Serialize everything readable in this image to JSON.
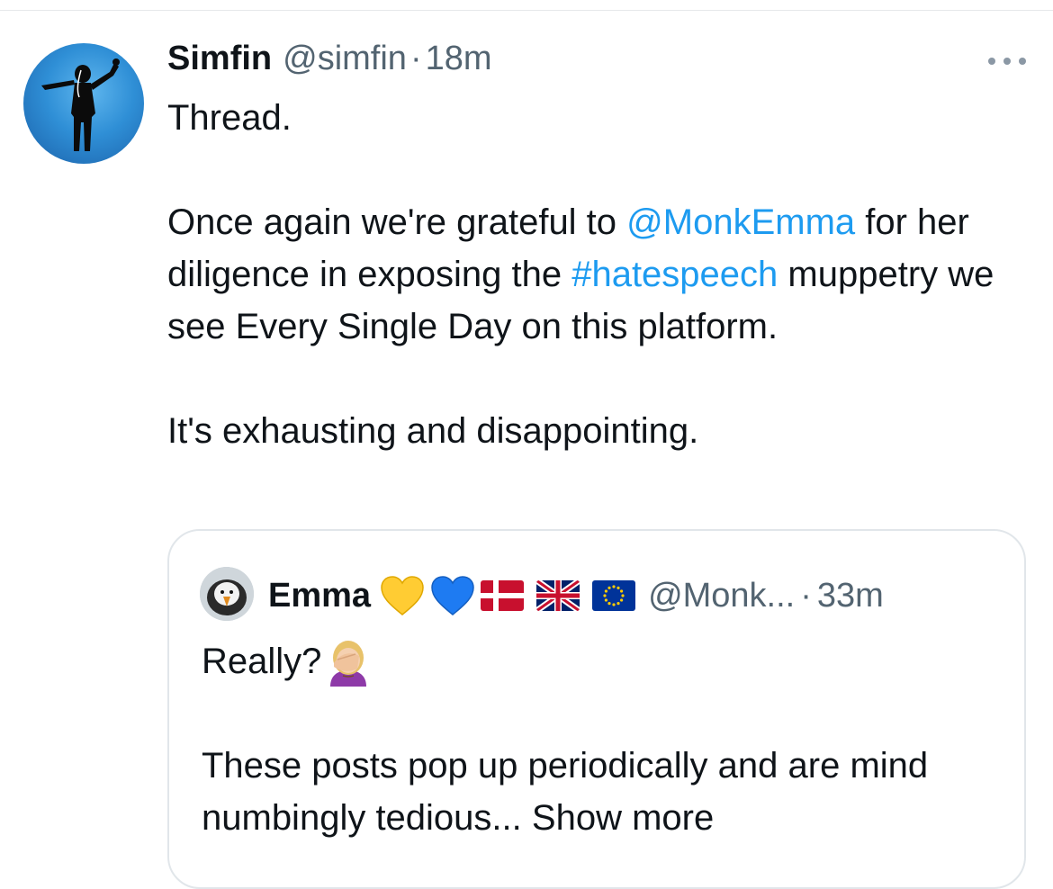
{
  "tweet": {
    "author_name": "Simfin",
    "author_handle": "@simfin",
    "separator": "·",
    "time": "18m",
    "line_thread": "Thread.",
    "body_part1": "Once again we're grateful to ",
    "mention": "@MonkEmma",
    "body_part2": " for her diligence in exposing the ",
    "hashtag": "#hatespeech",
    "body_part3": " muppetry we see Every Single Day on this platform.",
    "closing": "It's exhausting and disappointing."
  },
  "quoted_tweet": {
    "author_name": "Emma",
    "author_handle": "@Monk...",
    "separator": "·",
    "time": "33m",
    "first_line": "Really?",
    "body": "These posts pop up periodically and are mind numbingly tedious...",
    "show_more": "Show more",
    "badges": [
      "yellow-heart-icon",
      "blue-heart-icon",
      "denmark-flag-icon",
      "uk-flag-icon",
      "eu-flag-icon"
    ]
  },
  "colors": {
    "link": "#1d9bf0",
    "secondary_text": "#536471",
    "primary_text": "#0f1419",
    "border": "#e1e6ea"
  }
}
